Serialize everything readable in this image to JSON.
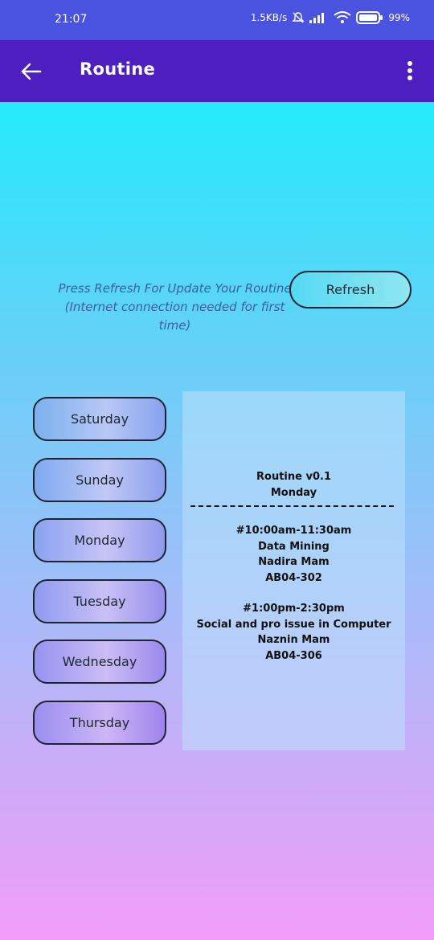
{
  "status_bar": {
    "time": "21:07",
    "net_speed": "1.5KB/s",
    "battery": "99%"
  },
  "app_bar": {
    "title": "Routine"
  },
  "refresh": {
    "hint": "Press Refresh For Update Your Routine (Internet connection needed for first time)",
    "button_label": "Refresh"
  },
  "days": [
    {
      "label": "Saturday"
    },
    {
      "label": "Sunday"
    },
    {
      "label": "Monday"
    },
    {
      "label": "Tuesday"
    },
    {
      "label": "Wednesday"
    },
    {
      "label": "Thursday"
    }
  ],
  "routine": {
    "version": "Routine v0.1",
    "day": "Monday",
    "classes": [
      {
        "time": "#10:00am-11:30am",
        "course": "Data Mining",
        "teacher": "Nadira Mam",
        "room": "AB04-302"
      },
      {
        "time": "#1:00pm-2:30pm",
        "course": "Social and pro issue in Computer",
        "teacher": "Naznin Mam",
        "room": "AB04-306"
      }
    ]
  },
  "colors": {
    "status_bar": "#4a52e0",
    "app_bar": "#4e1fc0",
    "gradient_top": "#07f5fc",
    "gradient_bottom": "#f19cf8"
  }
}
